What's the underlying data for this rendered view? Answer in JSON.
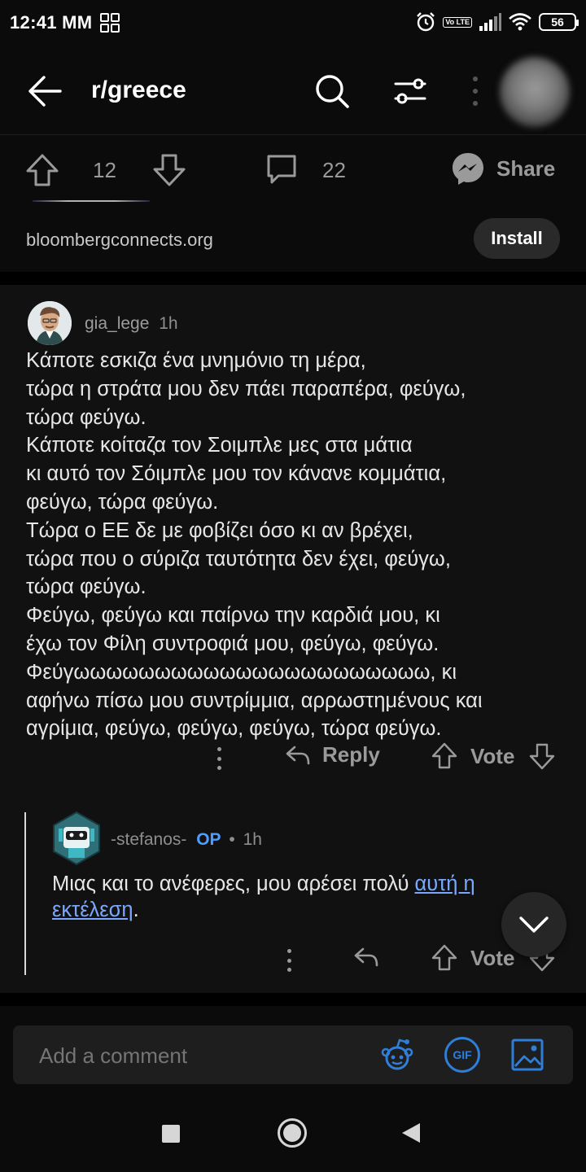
{
  "status_bar": {
    "time": "12:41 MM",
    "battery": "56",
    "network": "Vo LTE"
  },
  "app_bar": {
    "title": "r/greece"
  },
  "post_actions": {
    "score": "12",
    "comment_count": "22",
    "share_label": "Share"
  },
  "ad": {
    "domain": "bloombergconnects.org",
    "install_label": "Install"
  },
  "comment": {
    "author": "gia_lege",
    "age": "1h",
    "body": "Κάποτε εσκιζα ένα μνημόνιο τη μέρα,\nτώρα η στράτα μου δεν πάει παραπέρα, φεύγω,\nτώρα φεύγω.\nΚάποτε κοίταζα τον Σοιμπλε μες στα μάτια\nκι αυτό τον Σόιμπλε μου τον κάνανε κομμάτια,\nφεύγω, τώρα φεύγω.\nΤώρα ο ΕΕ δε με φοβίζει όσο κι αν βρέχει,\nτώρα που ο σύριζα ταυτότητα δεν έχει, φεύγω,\nτώρα φεύγω.\nΦεύγω, φεύγω και παίρνω την καρδιά μου, κι\nέχω τον Φίλη συντροφιά μου, φεύγω, φεύγω.\nΦεύγωωωωωωωωωωωωωωωωωωωωωω, κι\nαφήνω πίσω μου συντρίμμια, αρρωστημένους και\nαγρίμια, φεύγω, φεύγω, φεύγω, τώρα φεύγω.",
    "reply_label": "Reply",
    "vote_label": "Vote"
  },
  "reply": {
    "author": "-stefanos-",
    "op_badge": "OP",
    "separator": "•",
    "age": "1h",
    "body_text": "Μιας και το ανέφερες, μου αρέσει πολύ ",
    "link_text": "αυτή η εκτέλεση",
    "body_end": ".",
    "vote_label": "Vote"
  },
  "composer": {
    "placeholder": "Add a comment",
    "gif_label": "GIF"
  },
  "colors": {
    "background": "#0b0b0b",
    "panel": "#111111",
    "op_badge": "#4d9fff",
    "link": "#7aa8ff",
    "composer_icons": "#2f7fd8",
    "messenger_icon": "#9a9a9a"
  },
  "icons": [
    "back-arrow-icon",
    "search-icon",
    "filter-icon",
    "more-icon",
    "upvote-icon",
    "downvote-icon",
    "comment-icon",
    "messenger-icon",
    "reply-icon",
    "snoo-icon",
    "gif-icon",
    "image-icon",
    "chevron-down-icon"
  ]
}
